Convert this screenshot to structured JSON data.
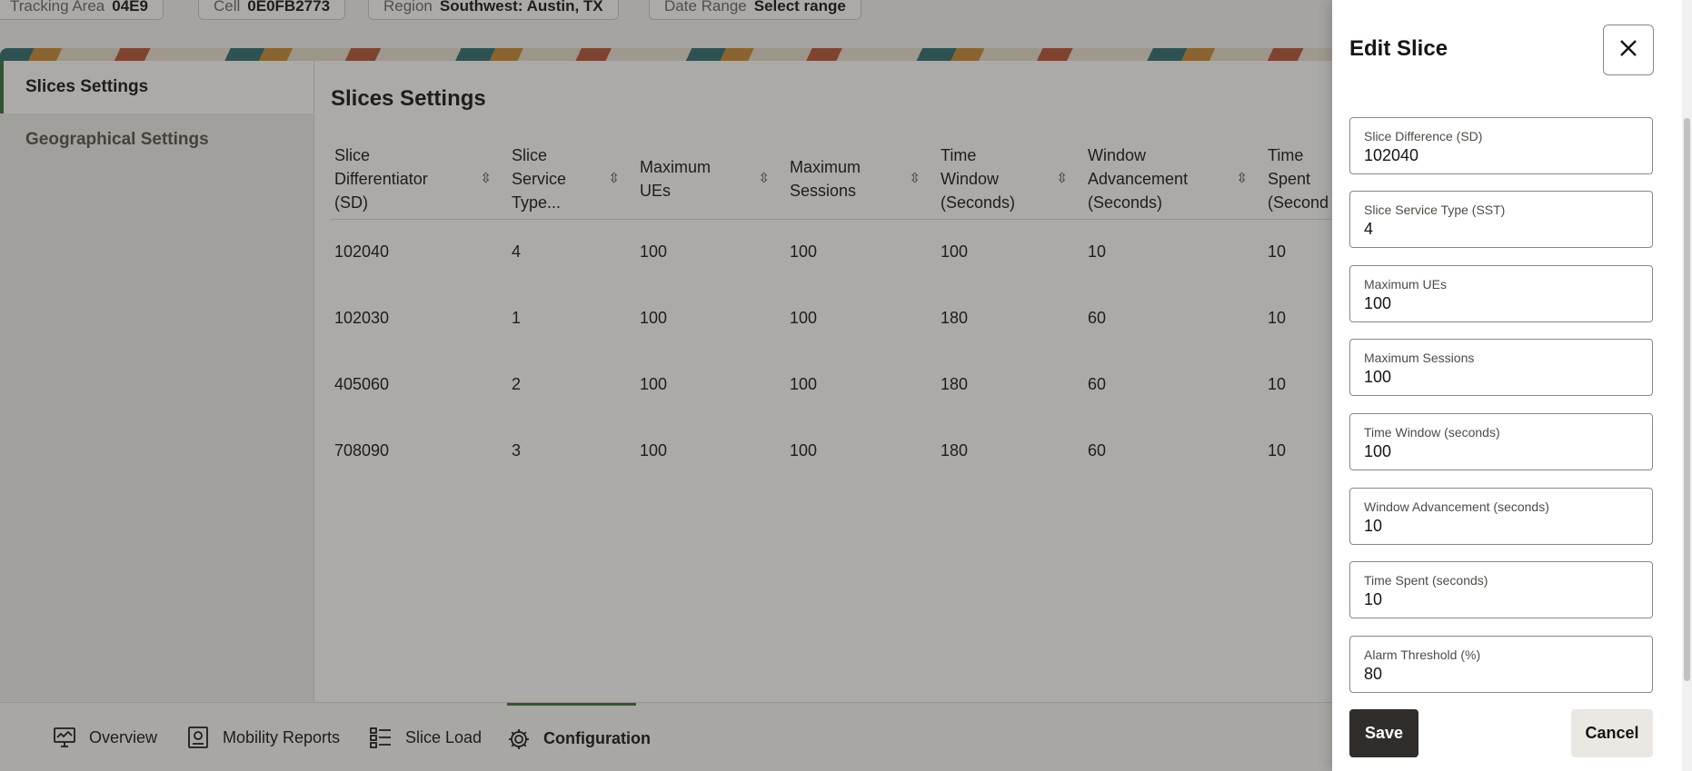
{
  "filters": [
    {
      "label": "Tracking Area",
      "value": "04E9"
    },
    {
      "label": "Cell",
      "value": "0E0FB2773"
    },
    {
      "label": "Region",
      "value": "Southwest: Austin, TX"
    },
    {
      "label": "Date Range",
      "value": "Select range"
    }
  ],
  "sidebar": {
    "items": [
      {
        "label": "Slices Settings"
      },
      {
        "label": "Geographical Settings"
      }
    ]
  },
  "main": {
    "title": "Slices Settings",
    "columns": [
      {
        "line1": "Slice",
        "line2": "Differentiator",
        "line3": "(SD)"
      },
      {
        "line1": "Slice",
        "line2": "Service",
        "line3": "Type..."
      },
      {
        "line1": "Maximum",
        "line2": "UEs",
        "line3": ""
      },
      {
        "line1": "Maximum",
        "line2": "Sessions",
        "line3": ""
      },
      {
        "line1": "Time",
        "line2": "Window",
        "line3": "(Seconds)"
      },
      {
        "line1": "Window",
        "line2": "Advancement",
        "line3": "(Seconds)"
      },
      {
        "line1": "Time",
        "line2": "Spent",
        "line3": "(Second"
      }
    ],
    "rows": [
      [
        "102040",
        "4",
        "100",
        "100",
        "100",
        "10",
        "10"
      ],
      [
        "102030",
        "1",
        "100",
        "100",
        "180",
        "60",
        "10"
      ],
      [
        "405060",
        "2",
        "100",
        "100",
        "180",
        "60",
        "10"
      ],
      [
        "708090",
        "3",
        "100",
        "100",
        "180",
        "60",
        "10"
      ]
    ]
  },
  "bottomnav": {
    "items": [
      {
        "label": "Overview",
        "icon": "monitor-chart-icon"
      },
      {
        "label": "Mobility Reports",
        "icon": "report-icon"
      },
      {
        "label": "Slice Load",
        "icon": "list-icon"
      },
      {
        "label": "Configuration",
        "icon": "gear-icon"
      }
    ]
  },
  "drawer": {
    "title": "Edit Slice",
    "fields": [
      {
        "label": "Slice Difference (SD)",
        "value": "102040"
      },
      {
        "label": "Slice Service Type (SST)",
        "value": "4"
      },
      {
        "label": "Maximum UEs",
        "value": "100"
      },
      {
        "label": "Maximum Sessions",
        "value": "100"
      },
      {
        "label": "Time Window (seconds)",
        "value": "100"
      },
      {
        "label": "Window Advancement (seconds)",
        "value": "10"
      },
      {
        "label": "Time Spent (seconds)",
        "value": "10"
      },
      {
        "label": "Alarm Threshold (%)",
        "value": "80"
      }
    ],
    "save_label": "Save",
    "cancel_label": "Cancel"
  },
  "colors": {
    "accent": "#3c6e3f",
    "primary_button": "#312d2a"
  }
}
